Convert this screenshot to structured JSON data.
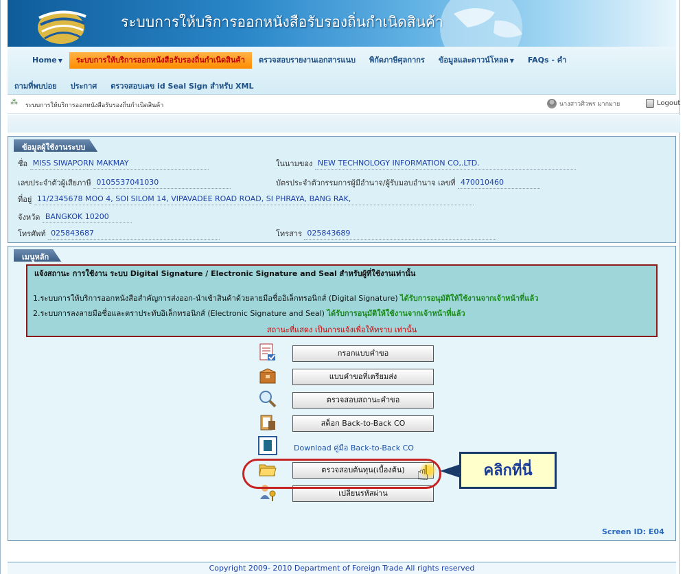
{
  "banner": {
    "title": "ระบบการให้บริการออกหนังสือรับรองถิ่นกำเนิดสินค้า"
  },
  "menu": {
    "row1": [
      {
        "label": "Home",
        "caret": true
      },
      {
        "label": "ระบบการให้บริการออกหนังสือรับรองถิ่นกำเนิดสินค้า",
        "active": true
      },
      {
        "label": "ตรวจสอบรายงานเอกสารแนบ"
      },
      {
        "label": "พิกัดภาษีศุลกากร"
      },
      {
        "label": "ข้อมูลและดาวน์โหลด",
        "caret": true
      },
      {
        "label": "FAQs - คำ"
      }
    ],
    "row2": [
      {
        "label": "ถามที่พบบ่อย"
      },
      {
        "label": "ประกาศ"
      },
      {
        "label": "ตรวจสอบเลข id Seal Sign สำหรับ XML"
      }
    ]
  },
  "breadcrumb": "ระบบการให้บริการออกหนังสือรับรองถิ่นกำเนิดสินค้า",
  "user_name": "นางสาวศิวพร มากมาย",
  "logout_label": "Logout",
  "info_panel": {
    "tab": "ข้อมูลผู้ใช้งานระบบ",
    "name_label": "ชื่อ",
    "name_value": "MISS SIWAPORN MAKMAY",
    "on_behalf_label": "ในนามของ",
    "on_behalf_value": "NEW TECHNOLOGY INFORMATION CO,.LTD.",
    "tax_id_label": "เลขประจำตัวผู้เสียภาษี",
    "tax_id_value": "0105537041030",
    "card_label": "บัตรประจำตัวกรรมการผู้มีอำนาจ/ผู้รับมอบอำนาจ เลขที่",
    "card_value": "470010460",
    "address_label": "ที่อยู่",
    "address_value": "11/2345678 MOO 4, SOI SILOM 14, VIPAVADEE ROAD ROAD, SI PHRAYA, BANG RAK,",
    "province_label": "จังหวัด",
    "province_value": "BANGKOK 10200",
    "phone_label": "โทรศัพท์",
    "phone_value": "025843687",
    "fax_label": "โทรสาร",
    "fax_value": "025843689"
  },
  "main_panel": {
    "tab": "เมนูหลัก",
    "notice_title": "แจ้งสถานะ การใช้งาน ระบบ Digital Signature / Electronic Signature and Seal สำหรับผู้ที่ใช้งานเท่านั้น",
    "notice_line1": "1.ระบบการให้บริการออกหนังสือสำคัญการส่งออก-นำเข้าสินค้าด้วยลายมือชื่ออิเล็กทรอนิกส์ (Digital Signature)",
    "notice_line1_status": "ได้รับการอนุมัติให้ใช้งานจากเจ้าหน้าที่แล้ว",
    "notice_line2": "2.ระบบการลงลายมือชื่อและตราประทับอิเล็กทรอนิกส์ (Electronic Signature and Seal)",
    "notice_line2_status": "ได้รับการอนุมัติให้ใช้งานจากเจ้าหน้าที่แล้ว",
    "notice_status": "สถานะที่แสดง เป็นการแจ้งเพื่อให้ทราบ เท่านั้น",
    "actions": [
      {
        "label": "กรอกแบบคำขอ",
        "icon": "form-icon"
      },
      {
        "label": "แบบคำขอที่เตรียมส่ง",
        "icon": "box-icon"
      },
      {
        "label": "ตรวจสอบสถานะคำขอ",
        "icon": "magnifier-icon"
      },
      {
        "label": "สต็อก Back-to-Back CO",
        "icon": "clipboard-icon"
      },
      {
        "label": "Download คู่มือ Back-to-Back CO",
        "icon": "book-icon",
        "link": true
      },
      {
        "label": "ตรวจสอบต้นทุน(เบื้องต้น)",
        "icon": "folder-icon"
      },
      {
        "label": "เปลี่ยนรหัสผ่าน",
        "icon": "key-user-icon"
      }
    ],
    "callout": "คลิกที่นี่",
    "screen_id": "Screen ID: E04"
  },
  "footer": "Copyright 2009- 2010 Department of Foreign Trade All rights reserved"
}
